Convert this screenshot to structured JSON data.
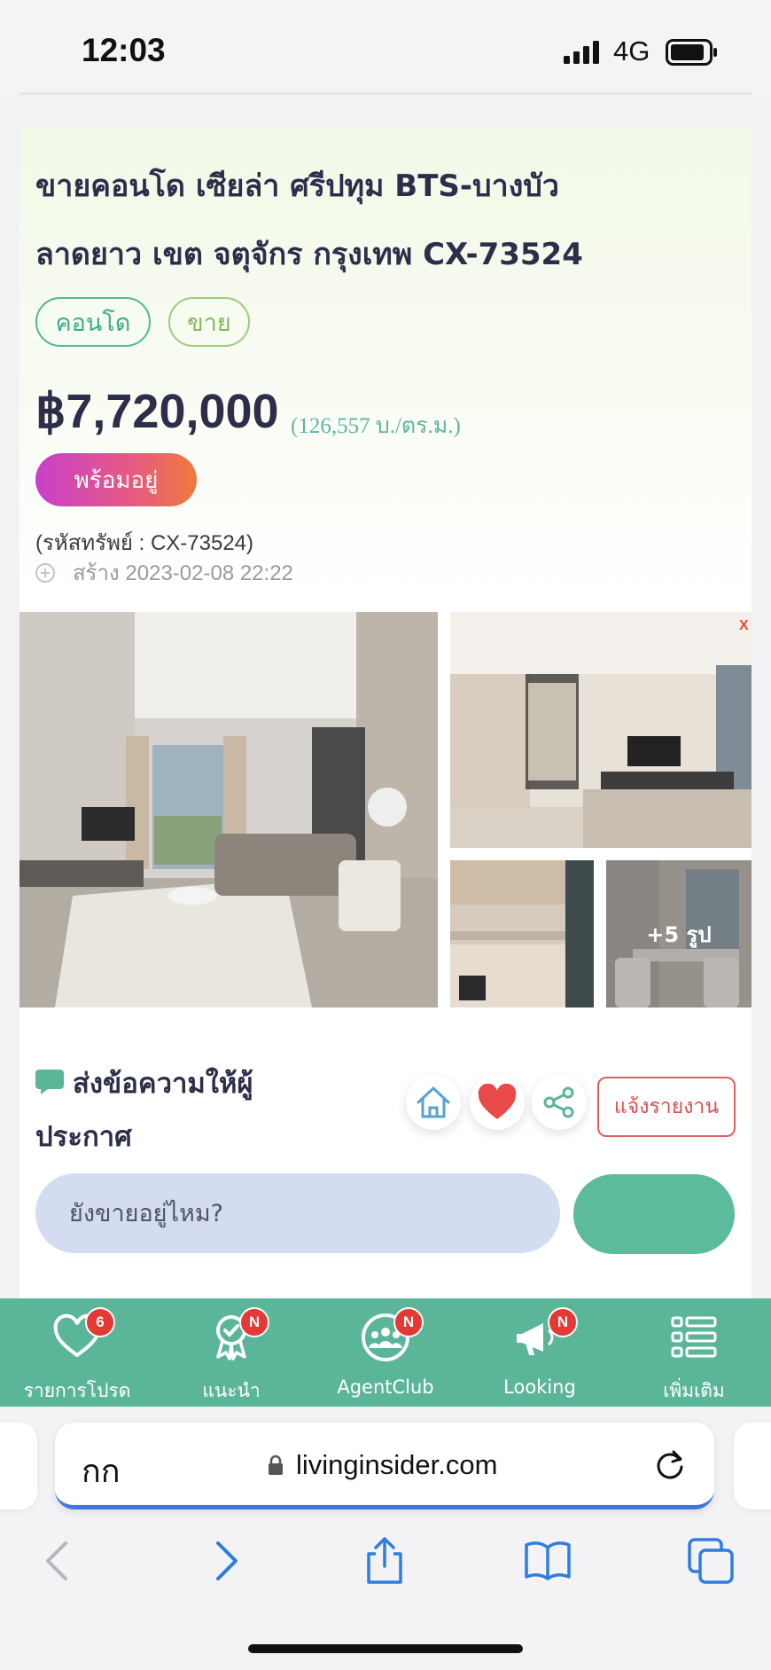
{
  "status_bar": {
    "time": "12:03",
    "network": "4G"
  },
  "listing": {
    "title_line1": "ขายคอนโด เซียล่า ศรีปทุม BTS-บางบัว",
    "title_line2": "ลาดยาว เขต จตุจักร กรุงเทพ CX-73524",
    "tags": [
      "คอนโด",
      "ขาย"
    ],
    "price": "฿7,720,000",
    "price_per_sqm": "(126,557 บ./ตร.ม.)",
    "status": "พร้อมอยู่",
    "code": "(รหัสทรัพย์ : CX-73524)",
    "created": "สร้าง 2023-02-08 22:22",
    "more_photos": "+5 รูป"
  },
  "message": {
    "title": "ส่งข้อความให้ผู้ประกาศ",
    "placeholder": "ยังขายอยู่ไหม?",
    "report_label": "แจ้งรายงาน"
  },
  "tabbar": {
    "items": [
      {
        "label": "รายการโปรด",
        "badge": "6",
        "icon": "heart-icon"
      },
      {
        "label": "แนะนำ",
        "badge": "N",
        "icon": "award-icon"
      },
      {
        "label": "AgentClub",
        "badge": "N",
        "icon": "group-icon"
      },
      {
        "label": "Looking",
        "badge": "N",
        "icon": "megaphone-icon"
      },
      {
        "label": "เพิ่มเติม",
        "badge": "",
        "icon": "list-icon"
      }
    ]
  },
  "browser": {
    "text_size_label": "กก",
    "url": "livinginsider.com"
  },
  "colors": {
    "accent_green": "#5bb598",
    "title_navy": "#2c2e4a",
    "report_red": "#e04e4e",
    "badge_red": "#e53935",
    "safari_blue": "#3f78dc"
  }
}
